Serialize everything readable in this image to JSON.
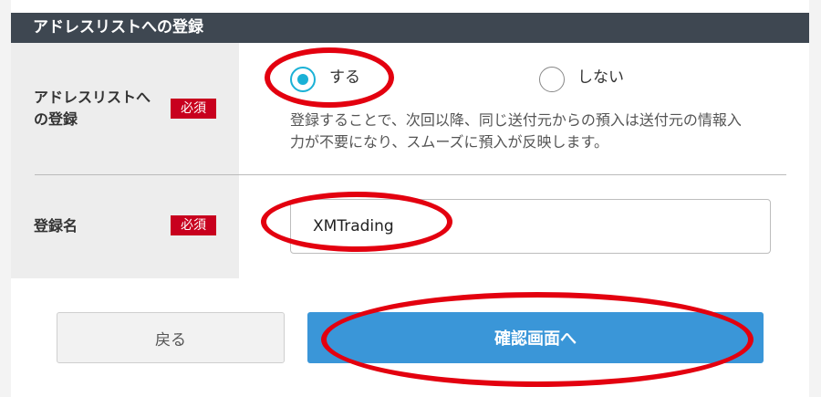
{
  "section": {
    "title": "アドレスリストへの登録"
  },
  "register_row": {
    "label_line1": "アドレスリストへ",
    "label_line2": "の登録",
    "required_badge": "必須",
    "options": [
      {
        "label": "する",
        "selected": true
      },
      {
        "label": "しない",
        "selected": false
      }
    ],
    "description_line1": "登録することで、次回以降、同じ送付元からの預入は送付元の情報入",
    "description_line2": "力が不要になり、スムーズに預入が反映します。"
  },
  "name_row": {
    "label": "登録名",
    "required_badge": "必須",
    "input_value": "XMTrading"
  },
  "buttons": {
    "back_label": "戻る",
    "confirm_label": "確認画面へ"
  },
  "colors": {
    "header_bg": "#3e4751",
    "required_badge_bg": "#c8001e",
    "radio_accent": "#1ab1d6",
    "confirm_button_bg": "#3a96d8",
    "highlight_ring": "#e3000f"
  }
}
